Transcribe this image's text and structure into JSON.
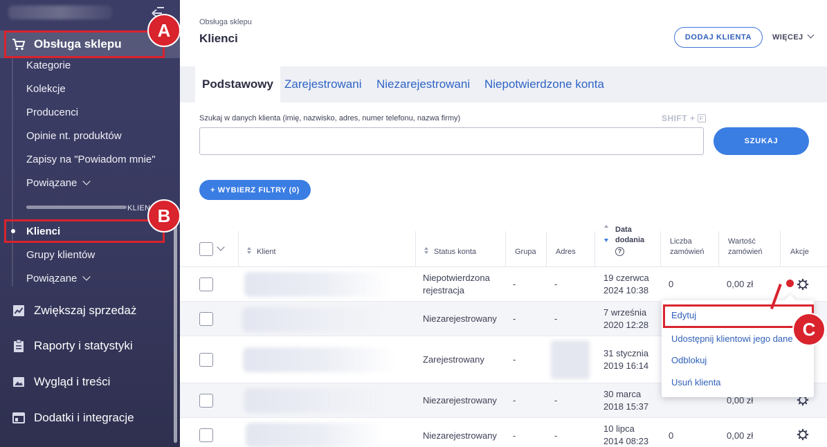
{
  "sidebar": {
    "main_items": [
      {
        "label": "Obsługa sklepu",
        "icon": "cart-icon"
      },
      {
        "label": "Zwiększaj sprzedaż",
        "icon": "chart-icon"
      },
      {
        "label": "Raporty i statystyki",
        "icon": "clipboard-icon"
      },
      {
        "label": "Wygląd i treści",
        "icon": "image-icon"
      },
      {
        "label": "Dodatki i integracje",
        "icon": "window-icon"
      }
    ],
    "sub_items": [
      "Kategorie",
      "Kolekcje",
      "Producenci",
      "Opinie nt. produktów",
      "Zapisy na \"Powiadom mnie\"",
      "Powiązane"
    ],
    "section_tiny": "KLIEN",
    "sub_items_2": [
      "Klienci",
      "Grupy klientów",
      "Powiązane"
    ]
  },
  "annotations": {
    "a": "A",
    "b": "B",
    "c": "C",
    "color": "#d9232d"
  },
  "header": {
    "breadcrumb": "Obsługa sklepu",
    "title": "Klienci",
    "add_button": "DODAJ KLIENTA",
    "more_button": "WIĘCEJ"
  },
  "tabs": [
    "Podstawowy",
    "Zarejestrowani",
    "Niezarejestrowani",
    "Niepotwierdzone konta"
  ],
  "search": {
    "label": "Szukaj w danych klienta (imię, nazwisko, adres, numer telefonu, nazwa firmy)",
    "shortcut": "SHIFT +",
    "shortcut_key": "F",
    "value": "",
    "button": "SZUKAJ"
  },
  "filters_button": "+ WYBIERZ FILTRY (0)",
  "table": {
    "headers": {
      "client": "Klient",
      "status": "Status konta",
      "group": "Grupa",
      "address": "Adres",
      "date_line1": "Data",
      "date_line2": "dodania",
      "orders_line1": "Liczba",
      "orders_line2": "zamówień",
      "value_line1": "Wartość",
      "value_line2": "zamówień",
      "actions": "Akcje"
    },
    "rows": [
      {
        "status": [
          "Niepotwierdzona",
          "rejestracja"
        ],
        "group": "-",
        "address": "-",
        "date": [
          "19 czerwca",
          "2024 10:38"
        ],
        "orders": "0",
        "value": "0,00 zł"
      },
      {
        "status": [
          "Niezarejestrowany"
        ],
        "group": "-",
        "address": "-",
        "date": [
          "7 września",
          "2020 12:28"
        ],
        "orders": "",
        "value": ""
      },
      {
        "status": [
          "Zarejestrowany"
        ],
        "group": "-",
        "address": "",
        "date": [
          "31 stycznia",
          "2019 16:14"
        ],
        "orders": "",
        "value": ""
      },
      {
        "status": [
          "Niezarejestrowany"
        ],
        "group": "-",
        "address": "-",
        "date": [
          "30 marca",
          "2018 15:37"
        ],
        "orders": "",
        "value": "0,00 zł"
      },
      {
        "status": [
          "Niezarejestrowany"
        ],
        "group": "-",
        "address": "-",
        "date": [
          "10 lipca",
          "2014 08:23"
        ],
        "orders": "0",
        "value": "0,00 zł"
      }
    ]
  },
  "dropdown": [
    "Edytuj",
    "Udostępnij klientowi jego dane",
    "Odblokuj",
    "Usuń klienta"
  ]
}
